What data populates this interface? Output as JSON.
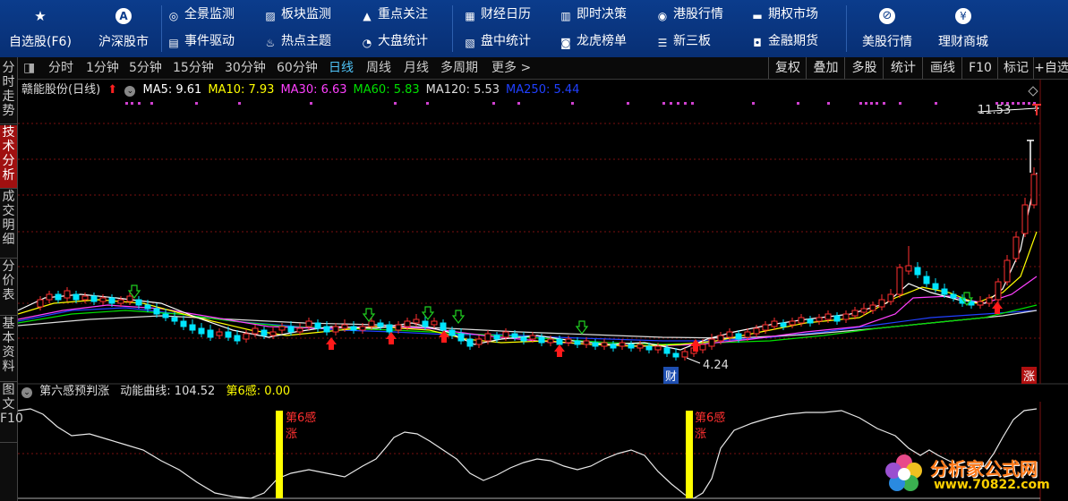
{
  "toolbar": {
    "big_buttons": [
      {
        "label": "自选股(F6)",
        "icon": "star-icon",
        "glyph": "★"
      },
      {
        "label": "沪深股市",
        "icon": "a-share-icon",
        "glyph": "A"
      }
    ],
    "groups": [
      [
        {
          "label": "全景监测",
          "icon": "monitor-icon",
          "glyph": "◎"
        },
        {
          "label": "事件驱动",
          "icon": "event-icon",
          "glyph": "▤"
        }
      ],
      [
        {
          "label": "板块监测",
          "icon": "sector-icon",
          "glyph": "▨"
        },
        {
          "label": "热点主题",
          "icon": "flame-icon",
          "glyph": "♨"
        }
      ],
      [
        {
          "label": "重点关注",
          "icon": "warning-icon",
          "glyph": "▲"
        },
        {
          "label": "大盘统计",
          "icon": "pie-icon",
          "glyph": "◔"
        }
      ],
      [
        {
          "label": "财经日历",
          "icon": "calendar-icon",
          "glyph": "▦"
        },
        {
          "label": "盘中统计",
          "icon": "chart-icon",
          "glyph": "▧"
        }
      ],
      [
        {
          "label": "即时决策",
          "icon": "bar-chart-icon",
          "glyph": "▥"
        },
        {
          "label": "龙虎榜单",
          "icon": "dragon-icon",
          "glyph": "◙"
        }
      ],
      [
        {
          "label": "港股行情",
          "icon": "globe-icon",
          "glyph": "◉"
        },
        {
          "label": "新三板",
          "icon": "board-icon",
          "glyph": "☰"
        }
      ],
      [
        {
          "label": "期权市场",
          "icon": "option-icon",
          "glyph": "▬"
        },
        {
          "label": "金融期货",
          "icon": "futures-icon",
          "glyph": "◘"
        }
      ]
    ],
    "right_buttons": [
      {
        "label": "美股行情",
        "icon": "us-stock-icon",
        "glyph": "⊘"
      },
      {
        "label": "理财商城",
        "icon": "money-bag-icon",
        "glyph": "¥"
      }
    ]
  },
  "side_tabs": [
    {
      "label": "分时走势",
      "active": false
    },
    {
      "label": "技术分析",
      "active": true
    },
    {
      "label": "成交明细",
      "active": false
    },
    {
      "label": "分价表",
      "active": false
    },
    {
      "label": "基本资料",
      "active": false
    },
    {
      "label": "图文F10",
      "active": false
    }
  ],
  "period_bar": {
    "items": [
      "分时",
      "1分钟",
      "5分钟",
      "15分钟",
      "30分钟",
      "60分钟",
      "日线",
      "周线",
      "月线",
      "多周期",
      "更多 >"
    ],
    "active": "日线",
    "right_items": [
      "复权",
      "叠加",
      "多股",
      "统计",
      "画线",
      "F10",
      "标记",
      "+自选"
    ]
  },
  "ma_legend": {
    "title": "赣能股份(日线)",
    "items": [
      {
        "text": "MA5: 9.61",
        "color": "#ffffff"
      },
      {
        "text": "MA10: 7.93",
        "color": "#ffff00"
      },
      {
        "text": "MA30: 6.63",
        "color": "#ff40ff"
      },
      {
        "text": "MA60: 5.83",
        "color": "#00e000"
      },
      {
        "text": "MA120: 5.53",
        "color": "#dddddd"
      },
      {
        "text": "MA250: 5.44",
        "color": "#2040ff"
      }
    ]
  },
  "price_labels": {
    "high": "11.53",
    "low": "4.24",
    "cai_badge": "财",
    "zhang_badge": "涨"
  },
  "indicator": {
    "title": "第六感预判涨",
    "curve_label": "动能曲线: 104.52",
    "signal_label": "第6感: 0.00",
    "signal_text_1": "第6感",
    "signal_text_2": "涨"
  },
  "watermark": {
    "title": "分析家公式网",
    "url": "www.70822.com"
  },
  "colors": {
    "up": "#ff3030",
    "down": "#00e5ff",
    "grid": "#7a1010",
    "toolbar_bg": "#0b3c8c"
  },
  "chart_data": {
    "type": "candlestick",
    "title": "赣能股份(日线)",
    "price_high": 11.53,
    "price_low": 4.24,
    "ma_values": {
      "MA5": 9.61,
      "MA10": 7.93,
      "MA30": 6.63,
      "MA60": 5.83,
      "MA120": 5.53,
      "MA250": 5.44
    },
    "indicator": {
      "name": "第六感预判涨",
      "curve_last": 104.52,
      "signal_last": 0.0,
      "signal_count": 2
    }
  }
}
